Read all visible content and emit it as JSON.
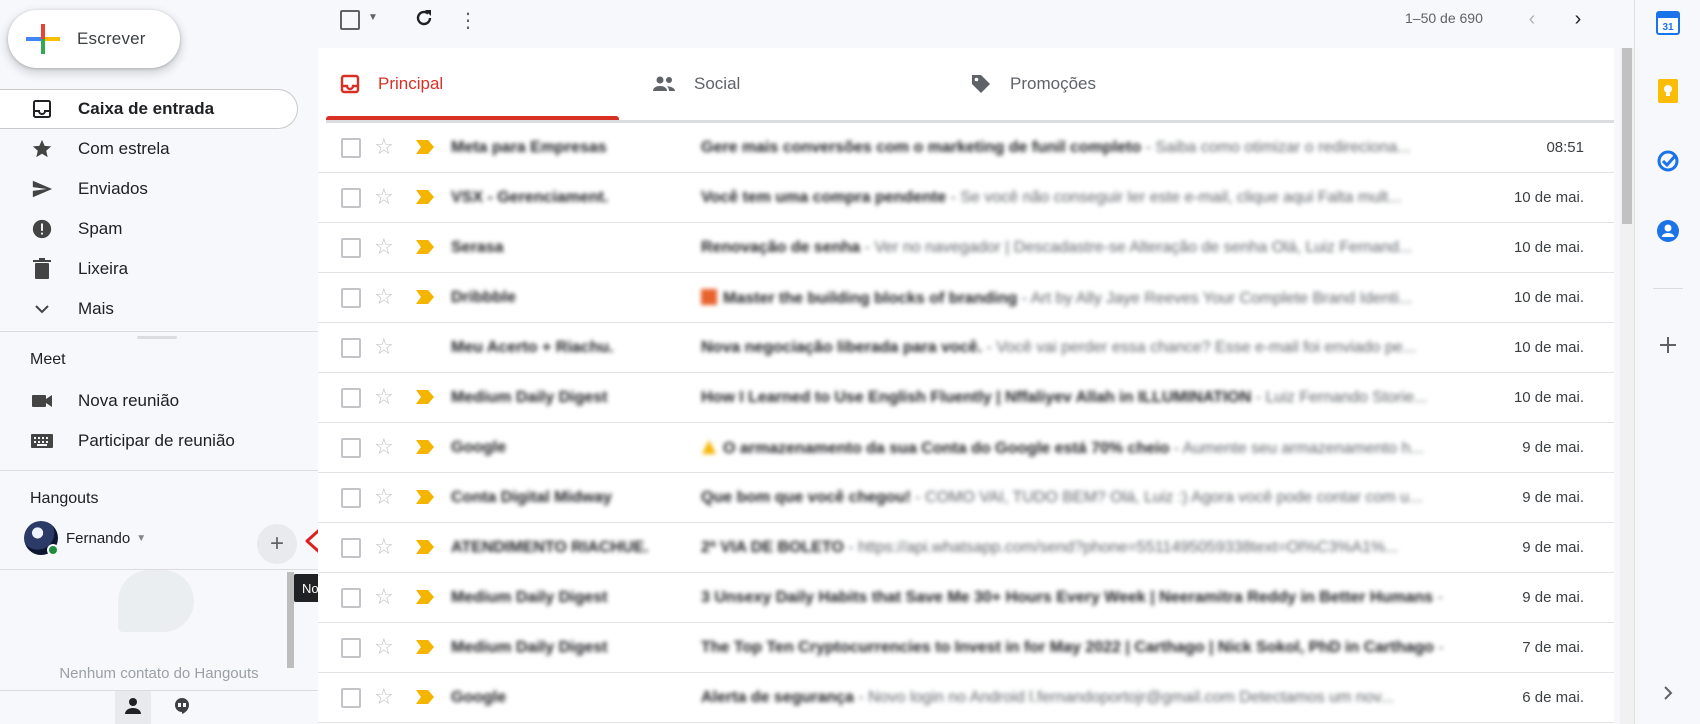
{
  "compose": {
    "label": "Escrever"
  },
  "nav": [
    {
      "label": "Caixa de entrada",
      "icon": "inbox-icon",
      "active": true
    },
    {
      "label": "Com estrela",
      "icon": "star-icon"
    },
    {
      "label": "Enviados",
      "icon": "send-icon"
    },
    {
      "label": "Spam",
      "icon": "report-icon"
    },
    {
      "label": "Lixeira",
      "icon": "trash-icon"
    },
    {
      "label": "Mais",
      "icon": "chevron-down-icon"
    }
  ],
  "meet": {
    "title": "Meet",
    "items": [
      {
        "label": "Nova reunião",
        "icon": "video-camera-icon"
      },
      {
        "label": "Participar de reunião",
        "icon": "keyboard-icon"
      }
    ]
  },
  "hangouts": {
    "title": "Hangouts",
    "user_name": "Fernando",
    "add_tooltip": "Nova conversa",
    "empty_text": "Nenhum contato do Hangouts"
  },
  "toolbar": {
    "pagination": "1–50 de 690"
  },
  "tabs": [
    {
      "label": "Principal",
      "icon": "inbox-icon",
      "active": true
    },
    {
      "label": "Social",
      "icon": "people-icon"
    },
    {
      "label": "Promoções",
      "icon": "tag-icon"
    }
  ],
  "emails": [
    {
      "sender": "Meta para Empresas",
      "subject": "Gere mais conversões com o marketing de funil completo",
      "snippet": " - Saiba como otimizar o redireciona...",
      "date": "08:51",
      "important": true
    },
    {
      "sender": "VSX - Gerenciament.",
      "subject": "Você tem uma compra pendente",
      "snippet": " - Se você não conseguir ler este e-mail, clique aqui Falta mult...",
      "date": "10 de mai.",
      "important": true
    },
    {
      "sender": "Serasa",
      "subject": "Renovação de senha",
      "snippet": " - Ver no navegador | Descadastre-se Alteração de senha Olá, Luiz Fernand...",
      "date": "10 de mai.",
      "important": true
    },
    {
      "sender": "Dribbble",
      "subject": "Master the building blocks of branding",
      "snippet": " - Art by Ally Jaye Reeves Your Complete Brand Identi...",
      "date": "10 de mai.",
      "important": true,
      "pre": "orange-square"
    },
    {
      "sender": "Meu Acerto + Riachu.",
      "subject": "Nova negociação liberada para você.",
      "snippet": " - Você vai perder essa chance? Esse e-mail foi enviado pe...",
      "date": "10 de mai.",
      "important": false
    },
    {
      "sender": "Medium Daily Digest",
      "subject": "How I Learned to Use English Fluently | Nffaliyev Allah in ILLUMINATION",
      "snippet": " - Luiz Fernando Storie...",
      "date": "10 de mai.",
      "important": true
    },
    {
      "sender": "Google",
      "subject": "O armazenamento da sua Conta do Google está 70% cheio",
      "snippet": " - Aumente seu armazenamento h...",
      "date": "9 de mai.",
      "important": true,
      "pre": "warning-triangle"
    },
    {
      "sender": "Conta Digital Midway",
      "subject": "Que bom que você chegou!",
      "snippet": " - COMO VAI, TUDO BEM? Olá, Luiz :) Agora você pode contar com u...",
      "date": "9 de mai.",
      "important": true
    },
    {
      "sender": "ATENDIMENTO RIACHUE.",
      "subject": "2ª VIA DE BOLETO",
      "snippet": " - https://api.whatsapp.com/send?phone=5511495059338text=Ol%C3%A1%...",
      "date": "9 de mai.",
      "important": true
    },
    {
      "sender": "Medium Daily Digest",
      "subject": "3 Unsexy Daily Habits that Save Me 30+ Hours Every Week | Neeramitra Reddy in Better Humans",
      "snippet": " -",
      "date": "9 de mai.",
      "important": true
    },
    {
      "sender": "Medium Daily Digest",
      "subject": "The Top Ten Cryptocurrencies to Invest in for May 2022 | Carthago | Nick Sokol, PhD in Carthago",
      "snippet": " -",
      "date": "7 de mai.",
      "important": true
    },
    {
      "sender": "Google",
      "subject": "Alerta de segurança",
      "snippet": " - Novo login no Android l.fernandoportojr@gmail.com Detectamos um nov...",
      "date": "6 de mai.",
      "important": true
    }
  ],
  "rail": [
    {
      "icon": "calendar-icon",
      "text": "31"
    },
    {
      "icon": "keep-icon"
    },
    {
      "icon": "tasks-icon"
    },
    {
      "icon": "contacts-icon"
    },
    {
      "icon": "add-icon"
    }
  ],
  "colors": {
    "accent_red": "#d93025",
    "important_yellow": "#f4b400",
    "online_green": "#1e8e3e"
  }
}
